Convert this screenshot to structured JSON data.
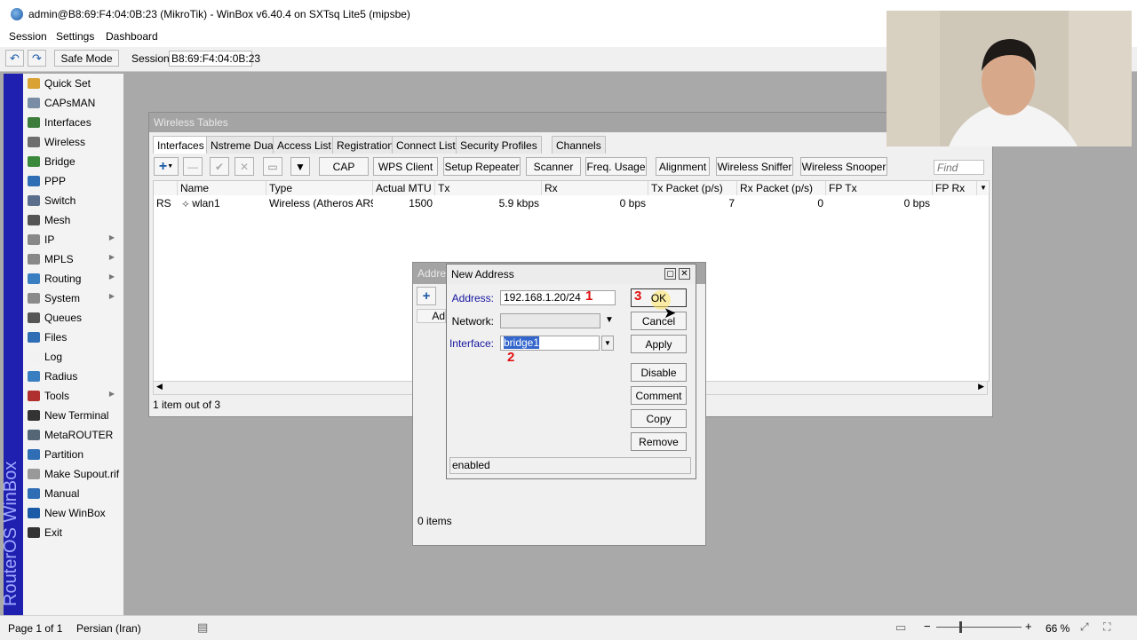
{
  "window": {
    "title": "admin@B8:69:F4:04:0B:23 (MikroTik) - WinBox v6.40.4 on SXTsq Lite5 (mipsbe)"
  },
  "menu": [
    "Session",
    "Settings",
    "Dashboard"
  ],
  "toolbar": {
    "safe_mode": "Safe Mode",
    "session_label": "Session:",
    "session_value": "B8:69:F4:04:0B:23"
  },
  "brand": "RouterOS WinBox",
  "sidebar": [
    {
      "label": "Quick Set",
      "icon": "quick-set-icon",
      "color": "#d9a233",
      "sub": false
    },
    {
      "label": "CAPsMAN",
      "icon": "capsman-icon",
      "color": "#7a8da6",
      "sub": false
    },
    {
      "label": "Interfaces",
      "icon": "interfaces-icon",
      "color": "#3c7d3c",
      "sub": false
    },
    {
      "label": "Wireless",
      "icon": "wireless-icon",
      "color": "#6e6e6e",
      "sub": false
    },
    {
      "label": "Bridge",
      "icon": "bridge-icon",
      "color": "#3b8a3b",
      "sub": false
    },
    {
      "label": "PPP",
      "icon": "ppp-icon",
      "color": "#2f6db5",
      "sub": false
    },
    {
      "label": "Switch",
      "icon": "switch-icon",
      "color": "#5b6f8c",
      "sub": false
    },
    {
      "label": "Mesh",
      "icon": "mesh-icon",
      "color": "#555555",
      "sub": false
    },
    {
      "label": "IP",
      "icon": "ip-icon",
      "color": "#888888",
      "sub": true
    },
    {
      "label": "MPLS",
      "icon": "mpls-icon",
      "color": "#888888",
      "sub": true
    },
    {
      "label": "Routing",
      "icon": "routing-icon",
      "color": "#3a7ec2",
      "sub": true
    },
    {
      "label": "System",
      "icon": "system-icon",
      "color": "#8a8a8a",
      "sub": true
    },
    {
      "label": "Queues",
      "icon": "queues-icon",
      "color": "#555555",
      "sub": false
    },
    {
      "label": "Files",
      "icon": "files-icon",
      "color": "#2f6db5",
      "sub": false
    },
    {
      "label": "Log",
      "icon": "log-icon",
      "color": "#f2f2f2",
      "sub": false
    },
    {
      "label": "Radius",
      "icon": "radius-icon",
      "color": "#3a7ec2",
      "sub": false
    },
    {
      "label": "Tools",
      "icon": "tools-icon",
      "color": "#b03030",
      "sub": true
    },
    {
      "label": "New Terminal",
      "icon": "terminal-icon",
      "color": "#333333",
      "sub": false
    },
    {
      "label": "MetaROUTER",
      "icon": "metarouter-icon",
      "color": "#556677",
      "sub": false
    },
    {
      "label": "Partition",
      "icon": "partition-icon",
      "color": "#2f6db5",
      "sub": false
    },
    {
      "label": "Make Supout.rif",
      "icon": "supout-icon",
      "color": "#999999",
      "sub": false
    },
    {
      "label": "Manual",
      "icon": "manual-icon",
      "color": "#2f6db5",
      "sub": false
    },
    {
      "label": "New WinBox",
      "icon": "winbox-icon",
      "color": "#1b5aa6",
      "sub": false
    },
    {
      "label": "Exit",
      "icon": "exit-icon",
      "color": "#333333",
      "sub": false
    }
  ],
  "wireless_tables": {
    "title": "Wireless Tables",
    "tabs": [
      "Interfaces",
      "Nstreme Dual",
      "Access List",
      "Registration",
      "Connect List",
      "Security Profiles",
      "Channels"
    ],
    "buttons": [
      "CAP",
      "WPS Client",
      "Setup Repeater",
      "Scanner",
      "Freq. Usage",
      "Alignment",
      "Wireless Sniffer",
      "Wireless Snooper"
    ],
    "find_placeholder": "Find",
    "columns": [
      "Name",
      "Type",
      "Actual MTU",
      "Tx",
      "Rx",
      "Tx Packet (p/s)",
      "Rx Packet (p/s)",
      "FP Tx",
      "FP Rx"
    ],
    "row": {
      "flags": "RS",
      "name": "wlan1",
      "type": "Wireless (Atheros AR9...",
      "mtu": "1500",
      "tx": "5.9 kbps",
      "rx": "0 bps",
      "tx_packet": "7",
      "rx_packet": "0",
      "fp_tx": "0 bps"
    },
    "status": "1 item out of 3"
  },
  "address_list": {
    "title": "Addre",
    "col": "Ad",
    "status": "0 items"
  },
  "new_address": {
    "title": "New Address",
    "address_label": "Address:",
    "address_value": "192.168.1.20/24",
    "network_label": "Network:",
    "network_value": "",
    "interface_label": "Interface:",
    "interface_value": "bridge1",
    "buttons": {
      "ok": "OK",
      "cancel": "Cancel",
      "apply": "Apply",
      "disable": "Disable",
      "comment": "Comment",
      "copy": "Copy",
      "remove": "Remove"
    },
    "status": "enabled",
    "marks": [
      "1",
      "2",
      "3"
    ]
  },
  "statusbar": {
    "page": "Page 1 of 1",
    "language": "Persian (Iran)",
    "zoom": "66 %"
  }
}
